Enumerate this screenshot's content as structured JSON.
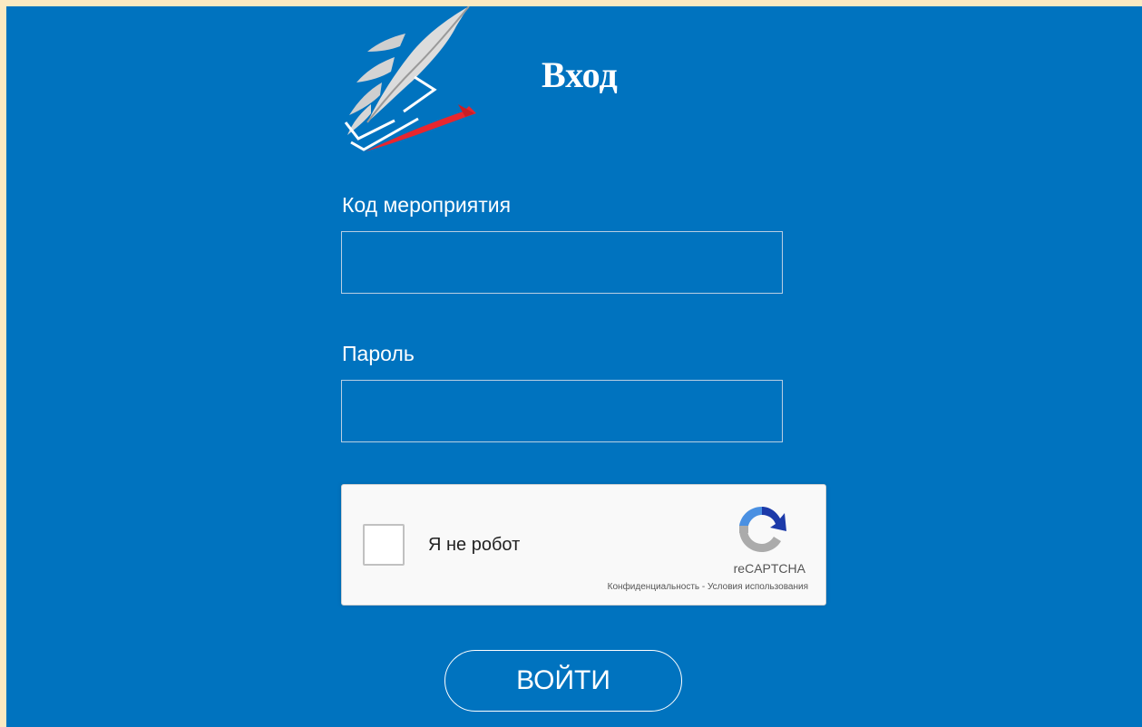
{
  "header": {
    "title": "Вход"
  },
  "form": {
    "event_code_label": "Код мероприятия",
    "event_code_value": "",
    "password_label": "Пароль",
    "password_value": "",
    "submit_label": "ВОЙТИ"
  },
  "recaptcha": {
    "checkbox_label": "Я не робот",
    "brand": "reCAPTCHA",
    "privacy_link": "Конфиденциальность",
    "separator": " - ",
    "terms_link": "Условия использования"
  },
  "colors": {
    "page_background": "#0073bf",
    "outer_background": "#fbe9c2",
    "logo_red": "#e8262e",
    "logo_feather": "#d8d8d8"
  },
  "icons": {
    "logo": "feather-quill-icon",
    "recaptcha": "recaptcha-logo-icon"
  }
}
